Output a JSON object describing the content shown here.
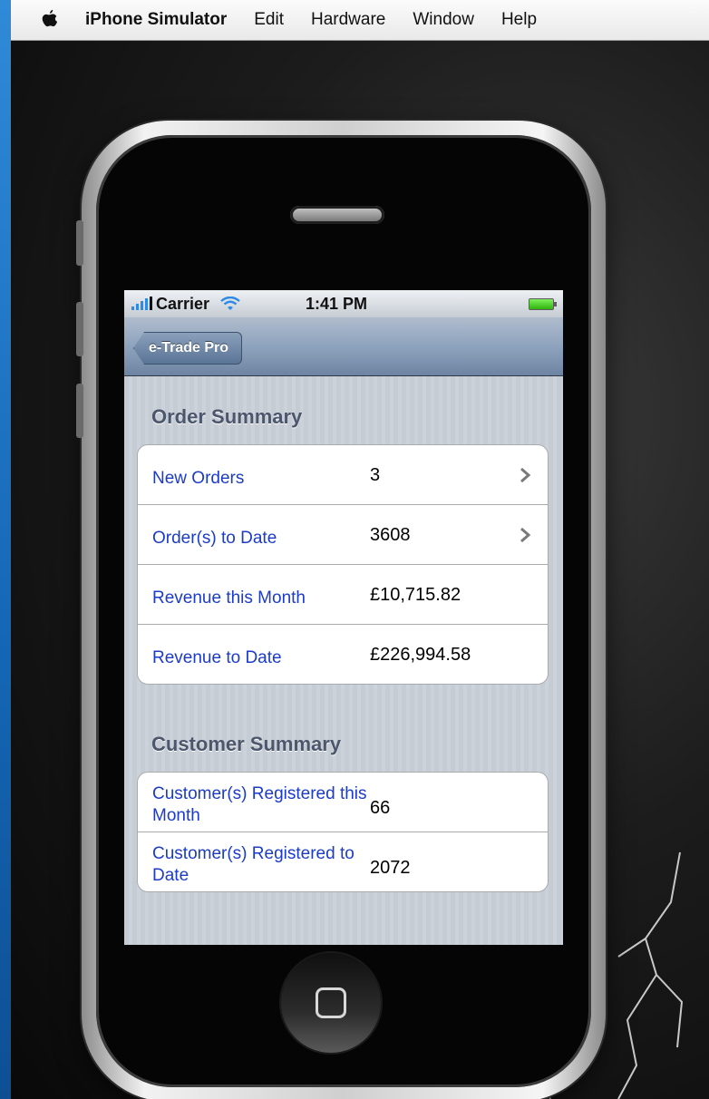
{
  "menubar": {
    "app_name": "iPhone Simulator",
    "items": [
      "Edit",
      "Hardware",
      "Window",
      "Help"
    ]
  },
  "statusbar": {
    "carrier": "Carrier",
    "time": "1:41 PM"
  },
  "navbar": {
    "back_label": "e-Trade Pro"
  },
  "order_summary": {
    "header": "Order Summary",
    "rows": [
      {
        "label": "New Orders",
        "value": "3"
      },
      {
        "label": "Order(s) to Date",
        "value": "3608"
      },
      {
        "label": "Revenue this Month",
        "value": "£10,715.82"
      },
      {
        "label": "Revenue to Date",
        "value": "£226,994.58"
      }
    ]
  },
  "customer_summary": {
    "header": "Customer Summary",
    "rows": [
      {
        "label": "Customer(s) Registered this Month",
        "value": "66"
      },
      {
        "label": "Customer(s) Registered to Date",
        "value": "2072"
      }
    ]
  },
  "colors": {
    "label_blue": "#1c3cc8",
    "section_text": "#4c566c",
    "navbar_blue": "#8ea3bd"
  },
  "icons": [
    "apple-icon",
    "signal-icon",
    "wifi-icon",
    "battery-icon",
    "chevron-right-icon",
    "home-square-icon"
  ]
}
